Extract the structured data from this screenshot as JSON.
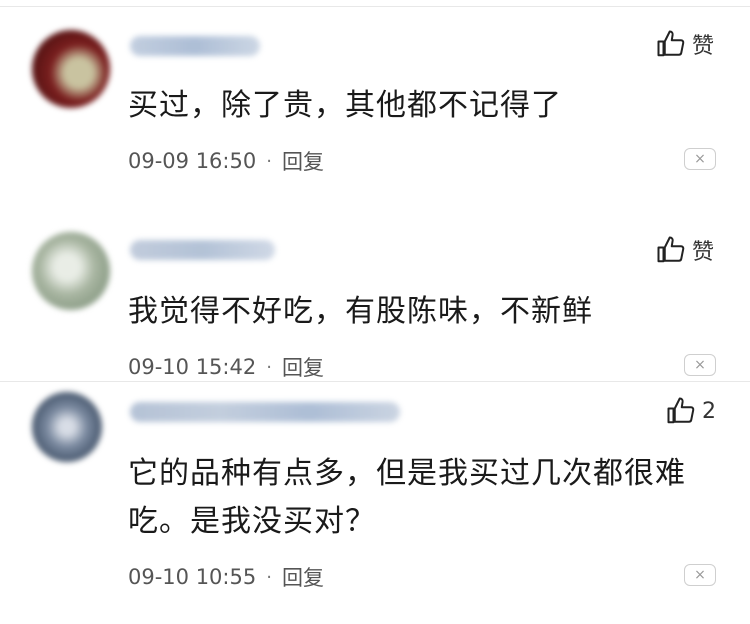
{
  "comments": [
    {
      "text": "买过，除了贵，其他都不记得了",
      "time": "09-09 16:50",
      "reply": "回复",
      "like_label": "赞",
      "close": "×"
    },
    {
      "text": "我觉得不好吃，有股陈味，不新鲜",
      "time": "09-10 15:42",
      "reply": "回复",
      "like_label": "赞",
      "close": "×"
    },
    {
      "text": "它的品种有点多，但是我买过几次都很难吃。是我没买对？",
      "time": "09-10 10:55",
      "reply": "回复",
      "like_label": "2",
      "close": "×"
    }
  ],
  "colors": {
    "avatar1": "#7a1e1e",
    "avatar2": "#8fa08a",
    "avatar3": "#4a5a70",
    "username": "#9fb3cf"
  },
  "icons": {
    "like": "thumbs-up-icon",
    "close": "close-icon"
  }
}
